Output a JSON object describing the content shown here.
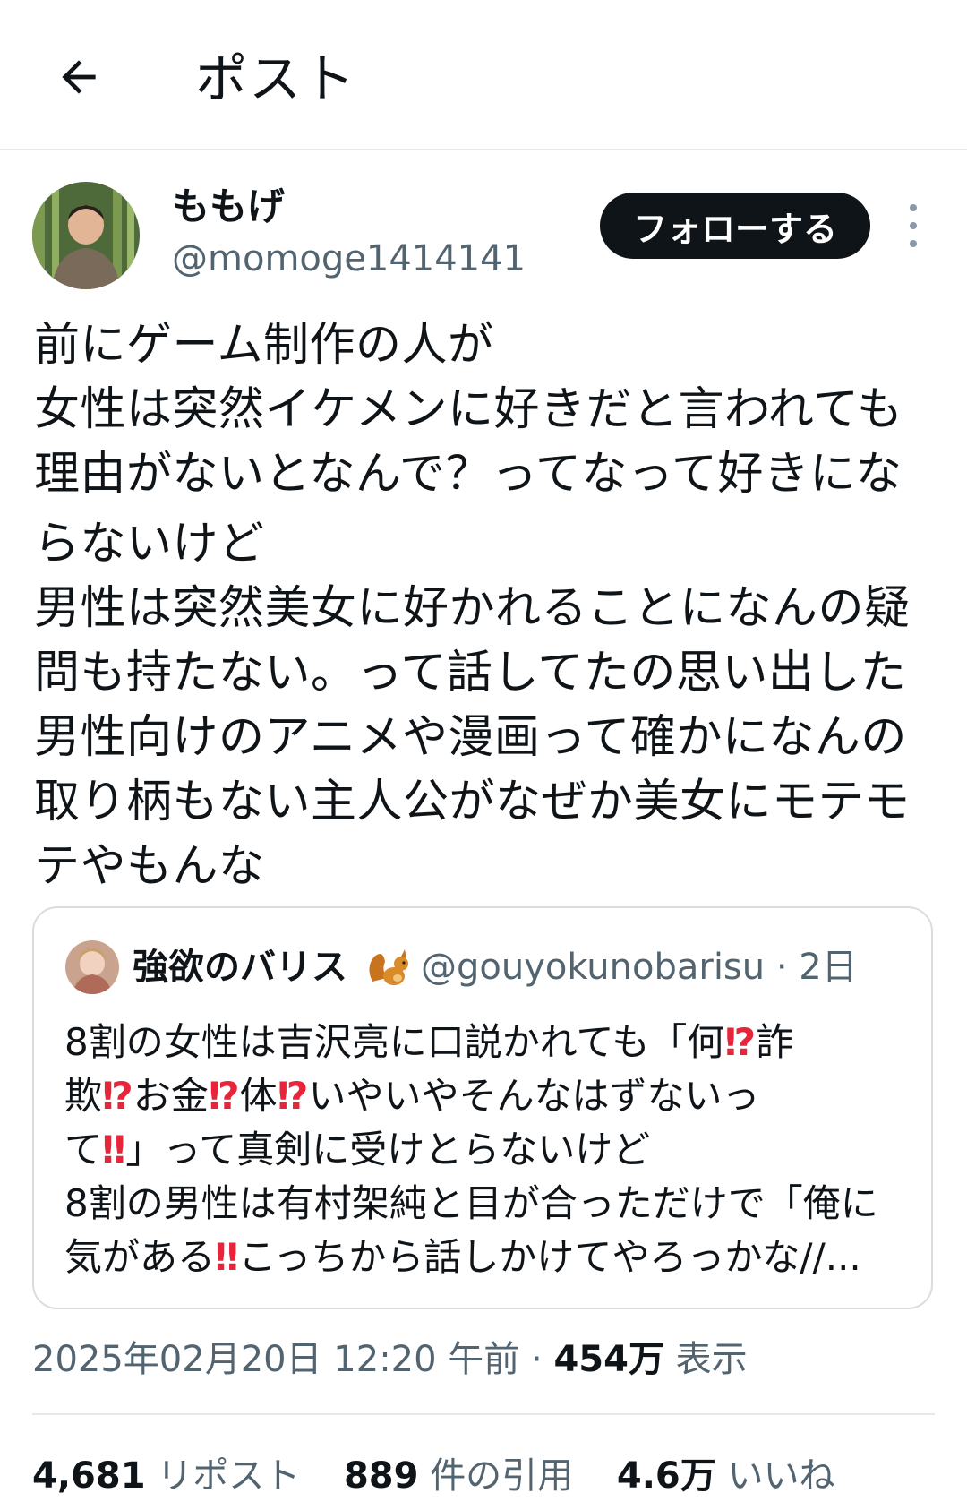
{
  "header": {
    "title": "ポスト",
    "back_icon": "arrow-left-icon"
  },
  "author": {
    "name": "ももげ",
    "handle": "@momoge1414141",
    "follow_label": "フォローする",
    "more_icon": "more-vertical-icon"
  },
  "post": {
    "lines": [
      "前にゲーム制作の人が",
      "女性は突然イケメンに好きだと言われても",
      "理由がないとなんで？ってなって好きにな",
      "らないけど",
      "男性は突然美女に好かれることになんの疑",
      "問も持たない。って話してたの思い出した",
      "男性向けのアニメや漫画って確かになんの",
      "取り柄もない主人公がなぜか美女にモテモ",
      "テやもんな"
    ]
  },
  "quote": {
    "name": "強欲のバリス",
    "emoji_icon": "squirrel-icon",
    "handle": "@gouyokunobarisu",
    "time": "2日",
    "separator": "·",
    "line1": {
      "a": "8割の女性は吉沢亮に口説かれても「何",
      "b1": "⁉",
      "c": "詐"
    },
    "line2": {
      "a": "欺",
      "b1": "⁉",
      "c": "お金",
      "b2": "⁉",
      "d": "体",
      "b3": "⁉",
      "e": "いやいやそんなはずないっ"
    },
    "line3": {
      "a": "て",
      "b1": "‼",
      "c": "」って真剣に受けとらないけど"
    },
    "line4": "8割の男性は有村架純と目が合っただけで「俺に",
    "line5": {
      "a": "気がある",
      "b1": "‼",
      "c": "こっちから話しかけてやろっかな//..."
    }
  },
  "meta": {
    "timestamp": "2025年02月20日 12:20 午前",
    "separator": "·",
    "views_count": "454万",
    "views_label": "表示"
  },
  "stats": {
    "reposts_count": "4,681",
    "reposts_label": "リポスト",
    "quotes_count": "889",
    "quotes_label": "件の引用",
    "likes_count": "4.6万",
    "likes_label": "いいね"
  },
  "colors": {
    "text": "#0f1419",
    "secondary": "#536471",
    "accent_bang": "#e8243b",
    "button_bg": "#0f1419"
  }
}
